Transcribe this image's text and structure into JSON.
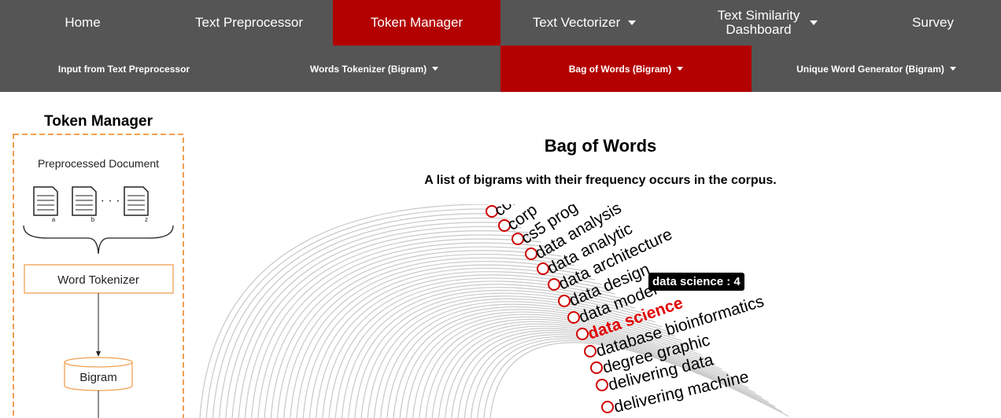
{
  "nav_primary": [
    {
      "label": "Home",
      "active": false,
      "dropdown": false
    },
    {
      "label": "Text Preprocessor",
      "active": false,
      "dropdown": false
    },
    {
      "label": "Token Manager",
      "active": true,
      "dropdown": false
    },
    {
      "label": "Text Vectorizer",
      "active": false,
      "dropdown": true
    },
    {
      "label": "Text Similarity Dashboard",
      "active": false,
      "dropdown": true
    },
    {
      "label": "Survey",
      "active": false,
      "dropdown": false
    }
  ],
  "nav_secondary": [
    {
      "label": "Input from Text Preprocessor",
      "active": false,
      "dropdown": false
    },
    {
      "label": "Words Tokenizer (Bigram)",
      "active": false,
      "dropdown": true
    },
    {
      "label": "Bag of Words (Bigram)",
      "active": true,
      "dropdown": true
    },
    {
      "label": "Unique Word Generator (Bigram)",
      "active": false,
      "dropdown": true
    }
  ],
  "diagram": {
    "title": "Token Manager",
    "preprocessed_label": "Preprocessed Document",
    "doc_labels": [
      "a",
      "b",
      "z"
    ],
    "dots": "· · ·",
    "tokenizer_label": "Word Tokenizer",
    "bigram_label": "Bigram"
  },
  "main": {
    "title": "Bag of Words",
    "subtitle": "A list of bigrams with their frequency occurs in the corpus."
  },
  "radial": {
    "words": [
      "cor",
      "corp",
      "cs5 prog",
      "data analysis",
      "data analytic",
      "data architecture",
      "data design",
      "data model",
      "data science",
      "database bioinformatics",
      "degree graphic",
      "delivering data",
      "delivering machine"
    ],
    "highlighted": "data science",
    "highlight_color": "#e00000",
    "tooltip": "data science : 4"
  }
}
